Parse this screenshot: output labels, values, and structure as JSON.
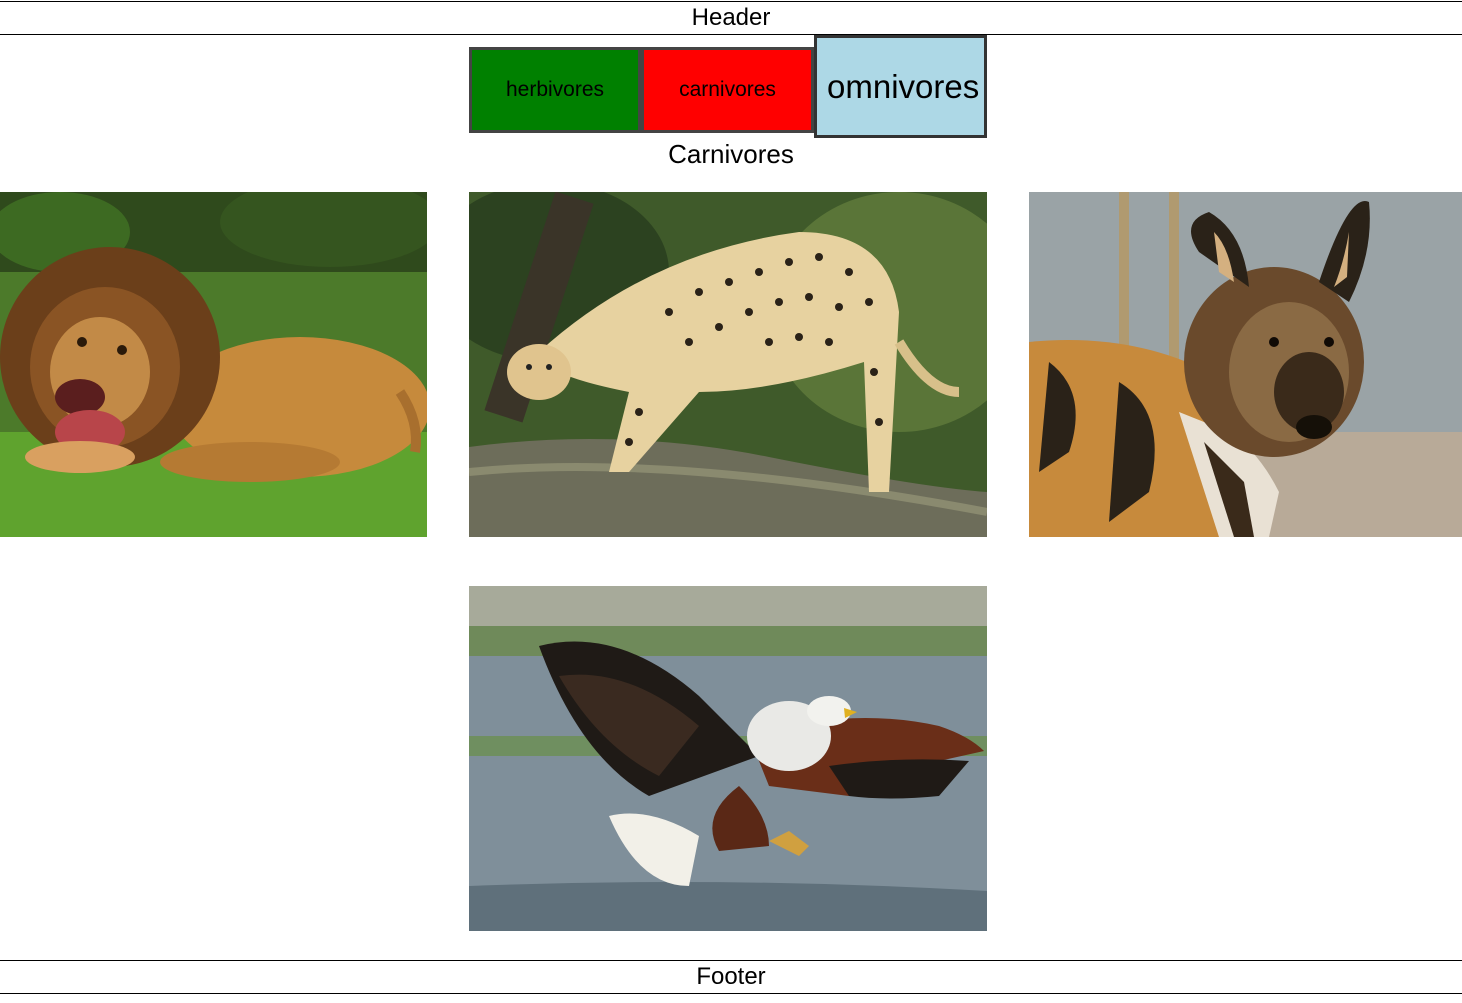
{
  "header": {
    "text": "Header"
  },
  "tabs": {
    "herbivores": "herbivores",
    "carnivores": "carnivores",
    "omnivores": "omnivores"
  },
  "section": {
    "title": "Carnivores"
  },
  "footer": {
    "text": "Footer"
  },
  "colors": {
    "herbivores_tab": "#008000",
    "carnivores_tab": "#ff0000",
    "omnivores_tab": "#add8e6"
  },
  "photos": [
    "lion-photo",
    "cheetah-photo",
    "wild-dog-photo",
    "fish-eagle-photo"
  ]
}
